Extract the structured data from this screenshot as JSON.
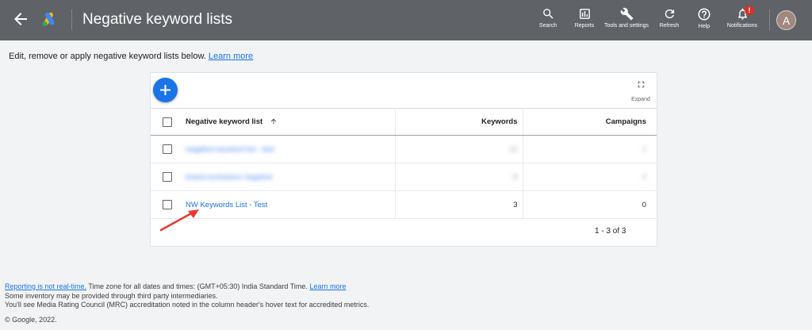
{
  "header": {
    "title": "Negative keyword lists",
    "tools": [
      {
        "label": "Search",
        "icon": "search-icon"
      },
      {
        "label": "Reports",
        "icon": "reports-icon"
      },
      {
        "label": "Tools and settings",
        "icon": "wrench-icon"
      },
      {
        "label": "Refresh",
        "icon": "refresh-icon"
      },
      {
        "label": "Help",
        "icon": "help-icon"
      },
      {
        "label": "Notifications",
        "icon": "bell-icon"
      }
    ],
    "notification_badge": "!",
    "avatar_letter": "A"
  },
  "intro": {
    "text": "Edit, remove or apply negative keyword lists below.",
    "learn_more": "Learn more"
  },
  "card": {
    "expand_label": "Expand",
    "columns": {
      "name": "Negative keyword list",
      "keywords": "Keywords",
      "campaigns": "Campaigns"
    },
    "rows": [
      {
        "name": "negative keyword list - test",
        "keywords": "12",
        "campaigns": "1"
      },
      {
        "name": "brand exclusions negative",
        "keywords": "8",
        "campaigns": "2"
      },
      {
        "name": "NW Keywords List - Test",
        "keywords": "3",
        "campaigns": "0"
      }
    ],
    "pagination": "1 - 3 of 3"
  },
  "footer": {
    "realtime_link": "Reporting is not real-time.",
    "timezone_text": "Time zone for all dates and times: (GMT+05:30) India Standard Time.",
    "learn_more": "Learn more",
    "line2": "Some inventory may be provided through third party intermediaries.",
    "line3": "You'll see Media Rating Council (MRC) accreditation noted in the column header's hover text for accredited metrics.",
    "copyright": "© Google, 2022."
  },
  "colors": {
    "topbar": "#5f6368",
    "accent": "#1a73e8",
    "arrow": "#e53935"
  }
}
